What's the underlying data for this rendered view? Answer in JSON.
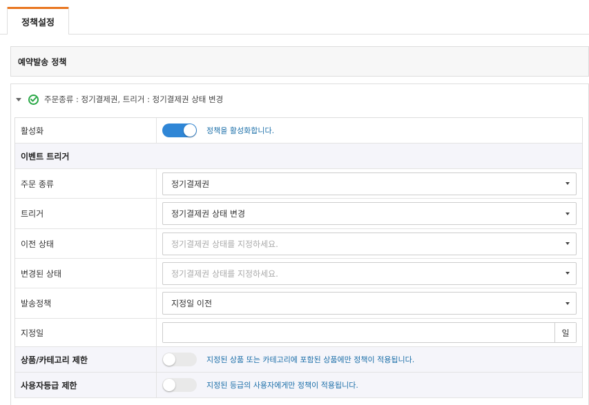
{
  "tabs": [
    {
      "label": "정책설정",
      "active": true
    }
  ],
  "section": {
    "title": "예약발송 정책"
  },
  "policy": {
    "title": "주문종류 : 정기결제권, 트리거 : 정기결제권 상태 변경",
    "rows": {
      "activate": {
        "label": "활성화",
        "enabled": true,
        "hint": "정책을 활성화합니다."
      },
      "event_trigger": {
        "label": "이벤트 트리거"
      },
      "order_type": {
        "label": "주문 종류",
        "value": "정기결제권"
      },
      "trigger": {
        "label": "트리거",
        "value": "정기결제권 상태 변경"
      },
      "prev_status": {
        "label": "이전 상태",
        "placeholder": "정기결제권 상태를 지정하세요."
      },
      "changed_status": {
        "label": "변경된 상태",
        "placeholder": "정기결제권 상태를 지정하세요."
      },
      "send_policy": {
        "label": "발송정책",
        "value": "지정일 이전"
      },
      "designated_day": {
        "label": "지정일",
        "value": "",
        "unit": "일"
      },
      "product_limit": {
        "label": "상품/카테고리 제한",
        "enabled": false,
        "hint": "지정된 상품 또는 카테고리에 포함된 상품에만 정책이 적용됩니다."
      },
      "user_grade_limit": {
        "label": "사용자등급 제한",
        "enabled": false,
        "hint": "지정된 등급의 사용자에게만 정책이 적용됩니다."
      }
    }
  },
  "colors": {
    "accent": "#e8741c",
    "toggle_on": "#2f86d6",
    "success": "#28a745",
    "hint": "#1a6ea8"
  }
}
